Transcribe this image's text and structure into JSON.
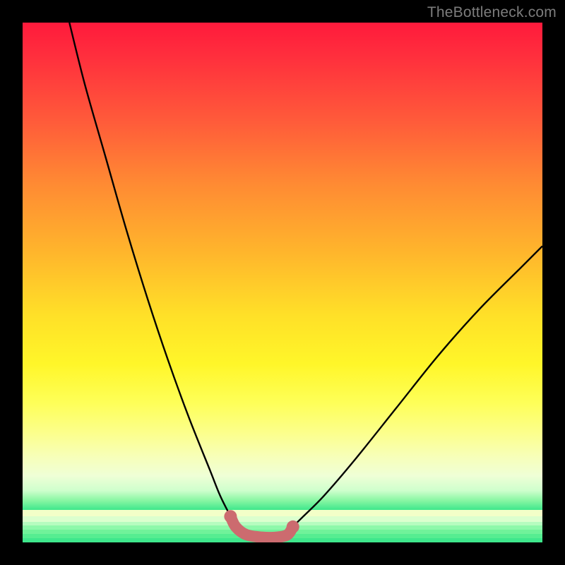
{
  "watermark": "TheBottleneck.com",
  "colors": {
    "frame": "#000000",
    "curve": "#000000",
    "highlight": "#cc6b6f",
    "gradient_top": "#ff1a3c",
    "gradient_bottom": "#3fe78c"
  },
  "chart_data": {
    "type": "line",
    "title": "",
    "xlabel": "",
    "ylabel": "",
    "xlim": [
      0,
      100
    ],
    "ylim": [
      0,
      100
    ],
    "grid": false,
    "legend": false,
    "notes": "Bottleneck-style V curve over red→yellow→green vertical gradient. Y is inverted visually (0 at bottom, 100 at top). The salmon-pink segment highlights the flat minimum region near x≈41–51.",
    "series": [
      {
        "name": "curve",
        "color": "#000000",
        "x": [
          9,
          12,
          16,
          20,
          24,
          28,
          32,
          36,
          38,
          40,
          41,
          43,
          46,
          49,
          51,
          52,
          54,
          58,
          64,
          72,
          80,
          88,
          96,
          100
        ],
        "y": [
          100,
          88,
          74,
          60,
          47,
          35,
          24,
          14,
          9,
          5,
          3,
          1.5,
          1,
          1,
          1.5,
          3,
          5,
          9,
          16,
          26,
          36,
          45,
          53,
          57
        ]
      },
      {
        "name": "highlight_min",
        "color": "#cc6b6f",
        "x": [
          40,
          41,
          43,
          46,
          49,
          51,
          52
        ],
        "y": [
          5,
          3,
          1.5,
          1,
          1,
          1.5,
          3
        ]
      }
    ],
    "bottom_bands": [
      {
        "color": "#3fe78c",
        "y_from": 0.0,
        "y_to": 0.8
      },
      {
        "color": "#56ed91",
        "y_from": 0.8,
        "y_to": 1.6
      },
      {
        "color": "#70f29a",
        "y_from": 1.6,
        "y_to": 2.4
      },
      {
        "color": "#8ef8aa",
        "y_from": 2.4,
        "y_to": 3.2
      },
      {
        "color": "#b6fcbf",
        "y_from": 3.2,
        "y_to": 4.0
      },
      {
        "color": "#dcffce",
        "y_from": 4.0,
        "y_to": 5.0
      },
      {
        "color": "#f3ffc8",
        "y_from": 5.0,
        "y_to": 6.2
      }
    ]
  }
}
